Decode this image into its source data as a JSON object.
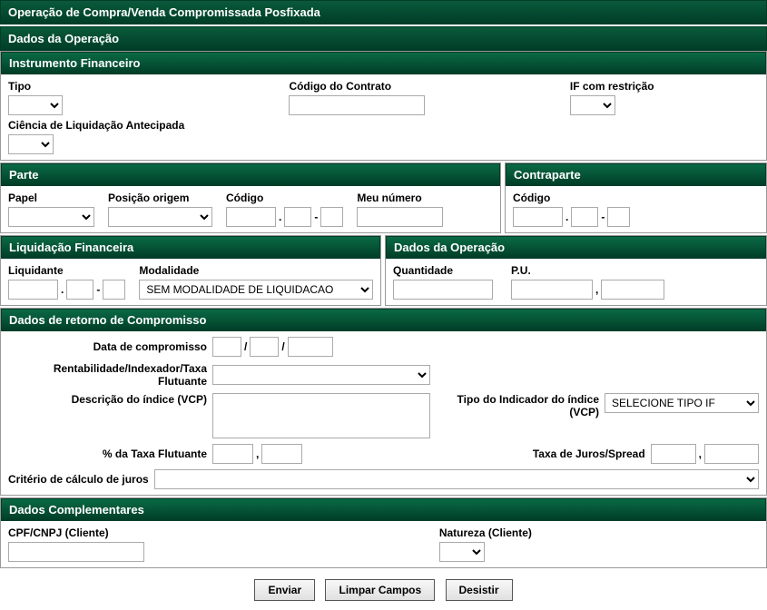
{
  "header": {
    "title": "Operação de Compra/Venda Compromissada Posfixada"
  },
  "dados_operacao_bar": "Dados da Operação",
  "instrumento": {
    "title": "Instrumento Financeiro",
    "tipo_label": "Tipo",
    "codigo_contrato_label": "Código do Contrato",
    "if_restricao_label": "IF com restrição",
    "ciencia_label": "Ciência de Liquidação Antecipada"
  },
  "parte": {
    "title": "Parte",
    "papel_label": "Papel",
    "posicao_origem_label": "Posição origem",
    "codigo_label": "Código",
    "meu_numero_label": "Meu número"
  },
  "contraparte": {
    "title": "Contraparte",
    "codigo_label": "Código"
  },
  "liquidacao": {
    "title": "Liquidação Financeira",
    "liquidante_label": "Liquidante",
    "modalidade_label": "Modalidade",
    "modalidade_value": "SEM MODALIDADE DE LIQUIDACAO"
  },
  "dados_op2": {
    "title": "Dados da Operação",
    "quantidade_label": "Quantidade",
    "pu_label": "P.U."
  },
  "retorno": {
    "title": "Dados de retorno de Compromisso",
    "data_label": "Data de compromisso",
    "rentabilidade_label": "Rentabilidade/Indexador/Taxa Flutuante",
    "descricao_label": "Descrição do índice (VCP)",
    "tipo_indicador_label": "Tipo do Indicador do índice (VCP)",
    "tipo_indicador_value": "SELECIONE TIPO IF",
    "pct_taxa_label": "% da Taxa Flutuante",
    "taxa_juros_label": "Taxa de Juros/Spread",
    "criterio_label": "Critério de cálculo de juros"
  },
  "complementares": {
    "title": "Dados Complementares",
    "cpf_label": "CPF/CNPJ (Cliente)",
    "natureza_label": "Natureza (Cliente)"
  },
  "buttons": {
    "enviar": "Enviar",
    "limpar": "Limpar Campos",
    "desistir": "Desistir"
  },
  "sep_slash": "/",
  "sep_dot": ".",
  "sep_dash": "-",
  "sep_comma": ","
}
